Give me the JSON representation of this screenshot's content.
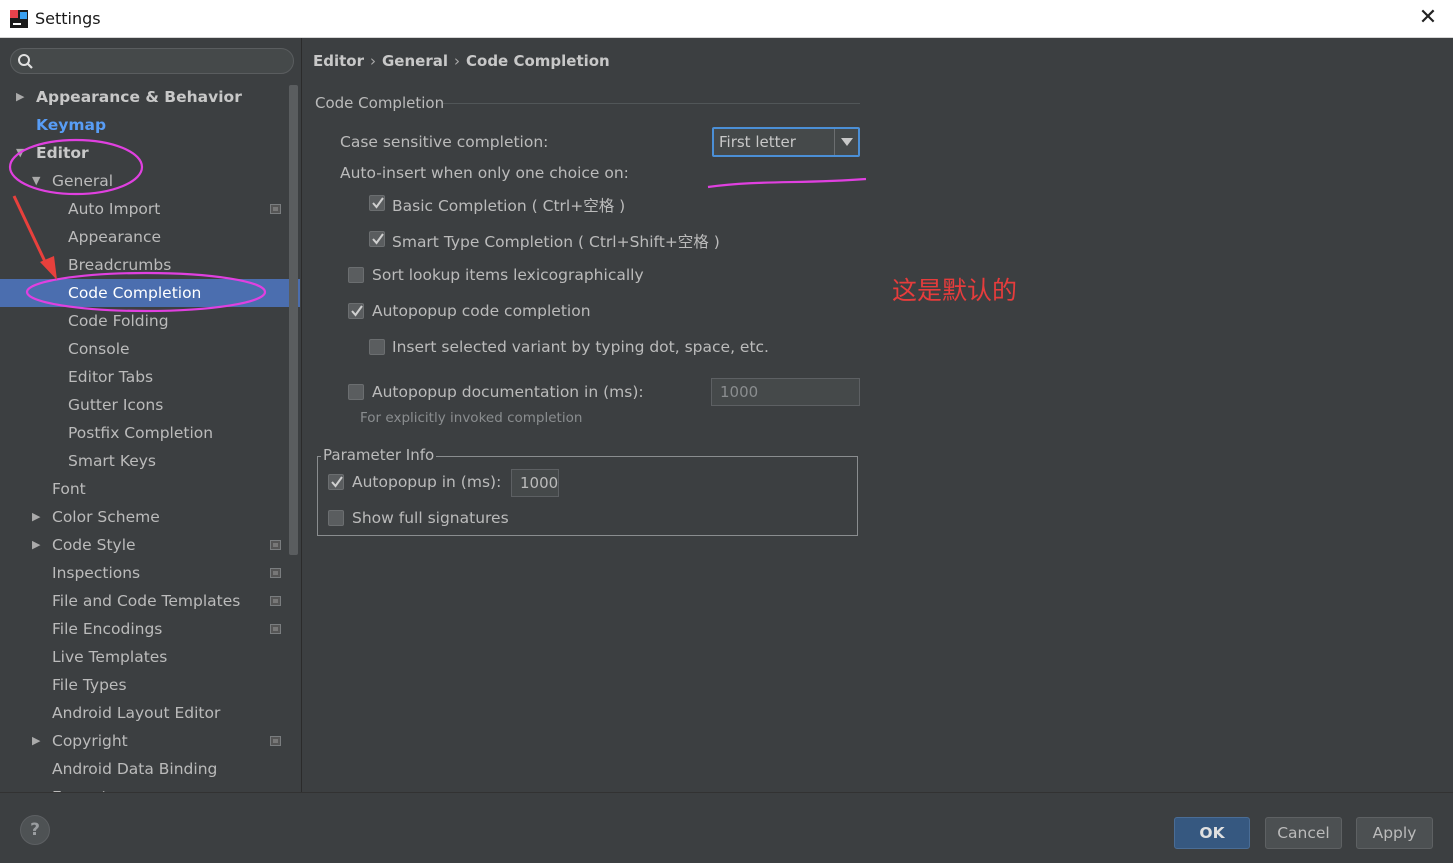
{
  "window": {
    "title": "Settings",
    "app_icon": "intellij-icon",
    "close_glyph": "✕"
  },
  "search": {
    "placeholder": "",
    "icon": "search-icon"
  },
  "sidebar": {
    "items": [
      {
        "label": "Appearance & Behavior",
        "depth": 0,
        "expander": "collapsed",
        "style": "bold"
      },
      {
        "label": "Keymap",
        "depth": 0,
        "expander": "none",
        "style": "link"
      },
      {
        "label": "Editor",
        "depth": 0,
        "expander": "expanded",
        "style": "bold"
      },
      {
        "label": "General",
        "depth": 1,
        "expander": "expanded",
        "style": "normal"
      },
      {
        "label": "Auto Import",
        "depth": 2,
        "expander": "none",
        "style": "normal",
        "project_icon": true
      },
      {
        "label": "Appearance",
        "depth": 2,
        "expander": "none",
        "style": "normal"
      },
      {
        "label": "Breadcrumbs",
        "depth": 2,
        "expander": "none",
        "style": "normal"
      },
      {
        "label": "Code Completion",
        "depth": 2,
        "expander": "none",
        "style": "normal",
        "selected": true
      },
      {
        "label": "Code Folding",
        "depth": 2,
        "expander": "none",
        "style": "normal"
      },
      {
        "label": "Console",
        "depth": 2,
        "expander": "none",
        "style": "normal"
      },
      {
        "label": "Editor Tabs",
        "depth": 2,
        "expander": "none",
        "style": "normal"
      },
      {
        "label": "Gutter Icons",
        "depth": 2,
        "expander": "none",
        "style": "normal"
      },
      {
        "label": "Postfix Completion",
        "depth": 2,
        "expander": "none",
        "style": "normal"
      },
      {
        "label": "Smart Keys",
        "depth": 2,
        "expander": "none",
        "style": "normal"
      },
      {
        "label": "Font",
        "depth": 1,
        "expander": "none",
        "style": "normal"
      },
      {
        "label": "Color Scheme",
        "depth": 1,
        "expander": "collapsed",
        "style": "normal"
      },
      {
        "label": "Code Style",
        "depth": 1,
        "expander": "collapsed",
        "style": "normal",
        "project_icon": true
      },
      {
        "label": "Inspections",
        "depth": 1,
        "expander": "none",
        "style": "normal",
        "project_icon": true
      },
      {
        "label": "File and Code Templates",
        "depth": 1,
        "expander": "none",
        "style": "normal",
        "project_icon": true
      },
      {
        "label": "File Encodings",
        "depth": 1,
        "expander": "none",
        "style": "normal",
        "project_icon": true
      },
      {
        "label": "Live Templates",
        "depth": 1,
        "expander": "none",
        "style": "normal"
      },
      {
        "label": "File Types",
        "depth": 1,
        "expander": "none",
        "style": "normal"
      },
      {
        "label": "Android Layout Editor",
        "depth": 1,
        "expander": "none",
        "style": "normal"
      },
      {
        "label": "Copyright",
        "depth": 1,
        "expander": "collapsed",
        "style": "normal",
        "project_icon": true
      },
      {
        "label": "Android Data Binding",
        "depth": 1,
        "expander": "none",
        "style": "normal"
      },
      {
        "label": "Emmet",
        "depth": 1,
        "expander": "collapsed",
        "style": "normal"
      }
    ]
  },
  "breadcrumb": {
    "part1": "Editor",
    "part2": "General",
    "part3": "Code Completion",
    "separator": "›"
  },
  "code_completion": {
    "group_title": "Code Completion",
    "case_sensitive_label": "Case sensitive completion:",
    "case_sensitive_value": "First letter",
    "auto_insert_label": "Auto-insert when only one choice on:",
    "basic_completion": {
      "label": "Basic Completion ( Ctrl+空格 )",
      "checked": true
    },
    "smart_type_completion": {
      "label": "Smart Type Completion ( Ctrl+Shift+空格 )",
      "checked": true
    },
    "sort_lookup": {
      "label": "Sort lookup items lexicographically",
      "checked": false
    },
    "autopopup_code": {
      "label": "Autopopup code completion",
      "checked": true
    },
    "insert_selected": {
      "label": "Insert selected variant by typing dot, space, etc.",
      "checked": false
    },
    "autopopup_doc": {
      "label": "Autopopup documentation in (ms):",
      "checked": false,
      "value": "1000"
    },
    "hint": "For explicitly invoked completion"
  },
  "parameter_info": {
    "title": "Parameter Info",
    "autopopup": {
      "label": "Autopopup in (ms):",
      "checked": true,
      "value": "1000"
    },
    "full_signatures": {
      "label": "Show full signatures",
      "checked": false
    }
  },
  "annotation_text": "这是默认的",
  "annotation_color": "#e63c3c",
  "highlight_color": "#e040e0",
  "buttons": {
    "ok": "OK",
    "cancel": "Cancel",
    "apply": "Apply",
    "help": "?"
  },
  "colors": {
    "background": "#3c3f41",
    "selection": "#4b6eaf",
    "link": "#589df6",
    "ok_button": "#365880"
  }
}
